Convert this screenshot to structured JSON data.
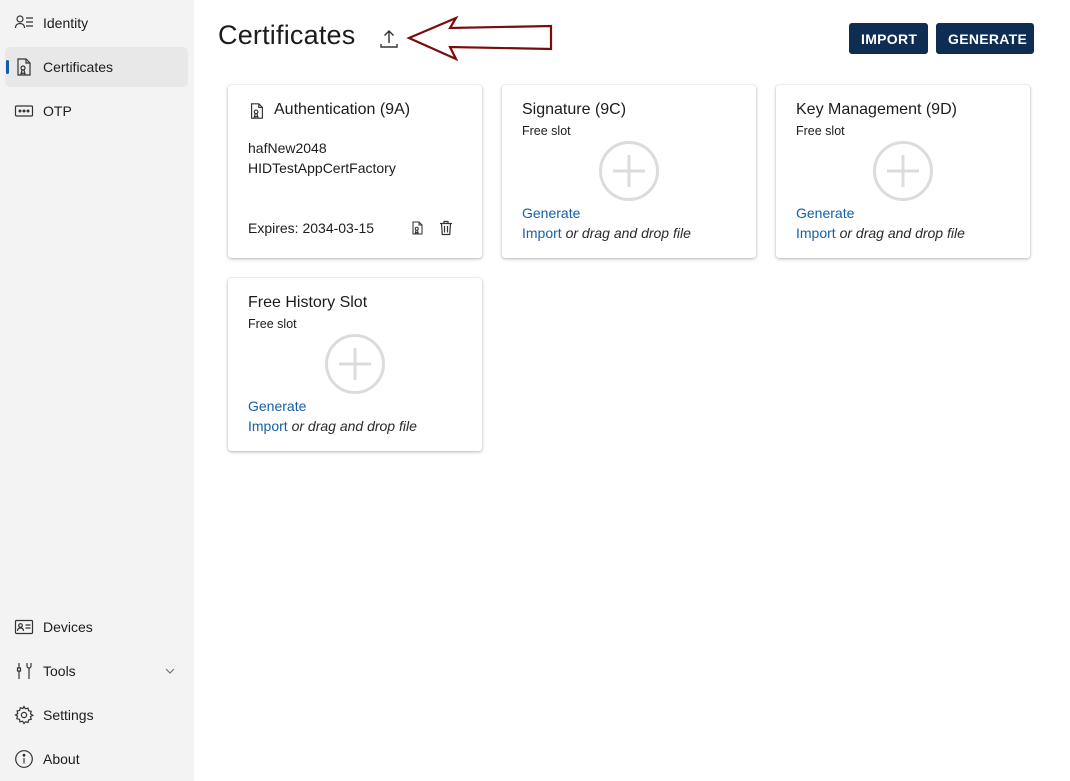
{
  "sidebar": {
    "top_items": [
      {
        "label": "Identity",
        "icon": "identity-icon"
      },
      {
        "label": "Certificates",
        "icon": "certificate-icon",
        "active": true
      },
      {
        "label": "OTP",
        "icon": "otp-icon"
      }
    ],
    "bottom_items": [
      {
        "label": "Devices",
        "icon": "devices-icon"
      },
      {
        "label": "Tools",
        "icon": "tools-icon"
      },
      {
        "label": "Settings",
        "icon": "gear-icon"
      },
      {
        "label": "About",
        "icon": "info-icon"
      }
    ]
  },
  "header": {
    "title": "Certificates",
    "import_label": "IMPORT",
    "generate_label": "GENERATE"
  },
  "cards": [
    {
      "title": "Authentication (9A)",
      "lines": [
        "hafNew2048",
        "HIDTestAppCertFactory"
      ],
      "expires": "Expires: 2034-03-15"
    },
    {
      "title": "Signature (9C)",
      "subtitle": "Free slot",
      "generate": "Generate",
      "import": "Import",
      "drag": " or drag and drop file"
    },
    {
      "title": "Key Management (9D)",
      "subtitle": "Free slot",
      "generate": "Generate",
      "import": "Import",
      "drag": " or drag and drop file"
    },
    {
      "title": "Free History Slot",
      "subtitle": "Free slot",
      "generate": "Generate",
      "import": "Import",
      "drag": " or drag and drop file"
    }
  ],
  "colors": {
    "accent": "#0d2d52",
    "link": "#1660a8",
    "active_indicator": "#0f5fa8",
    "annotation_arrow": "#7a0c0c"
  }
}
